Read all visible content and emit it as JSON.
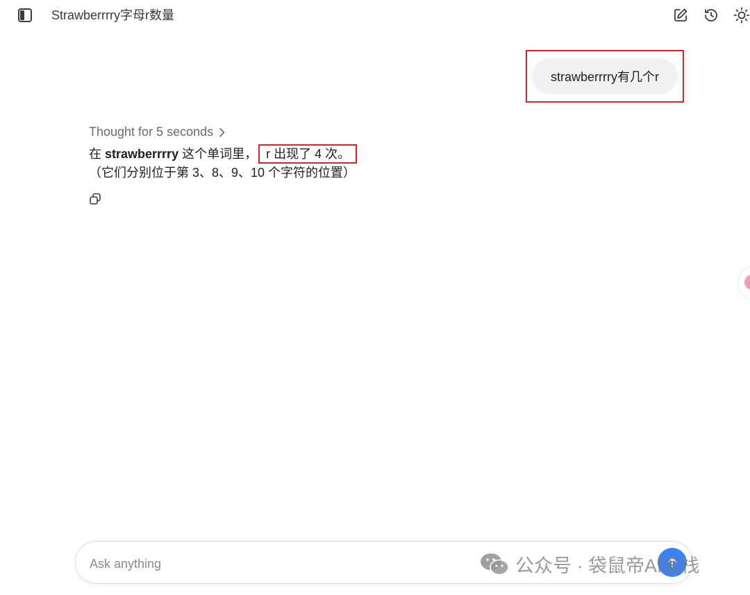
{
  "header": {
    "chat_title": "Strawberrrry字母r数量"
  },
  "conversation": {
    "user_message": "strawberrrry有几个r",
    "thought_label": "Thought for 5 seconds",
    "answer": {
      "prefix": "在 ",
      "word": "strawberrrry",
      "middle": " 这个单词里，",
      "highlight": "r 出现了 4 次。",
      "line2": "（它们分别位于第 3、8、9、10 个字符的位置）"
    }
  },
  "input": {
    "placeholder": "Ask anything",
    "value": ""
  },
  "watermark": {
    "text": "公众号 · 袋鼠帝AI客栈"
  },
  "colors": {
    "highlight_border": "#d8232a",
    "user_bubble": "#f1f1f1",
    "send_button": "#3b82f6"
  },
  "icons": {
    "sidebar": "sidebar-toggle-icon",
    "edit": "new-chat-edit-icon",
    "history": "history-icon",
    "theme": "sun-icon",
    "copy": "copy-icon",
    "send": "arrow-up-icon",
    "watermark": "wechat-icon"
  }
}
